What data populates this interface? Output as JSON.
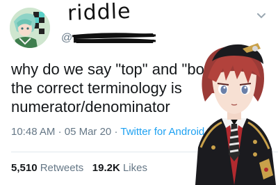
{
  "tweet": {
    "display_name": "riddle",
    "handle": "@",
    "text_lines": [
      "why do we say \"top\" and \"bottom\"?",
      "the correct terminology is",
      "numerator/denominator"
    ],
    "time": "10:48 AM",
    "separator": "·",
    "date": "05 Mar 20",
    "source": "Twitter for Android",
    "retweets_count": "5,510",
    "retweets_label": "Retweets",
    "likes_count": "19.2K",
    "likes_label": "Likes"
  },
  "icons": {
    "avatar": "anime-avatar-icon",
    "menu": "chevron-down-icon",
    "redaction": "redaction-scribble-icon",
    "character": "anime-character-illustration"
  },
  "colors": {
    "text": "#14171a",
    "muted": "#657786",
    "link": "#1da1f2",
    "divider": "#e1e8ed"
  }
}
